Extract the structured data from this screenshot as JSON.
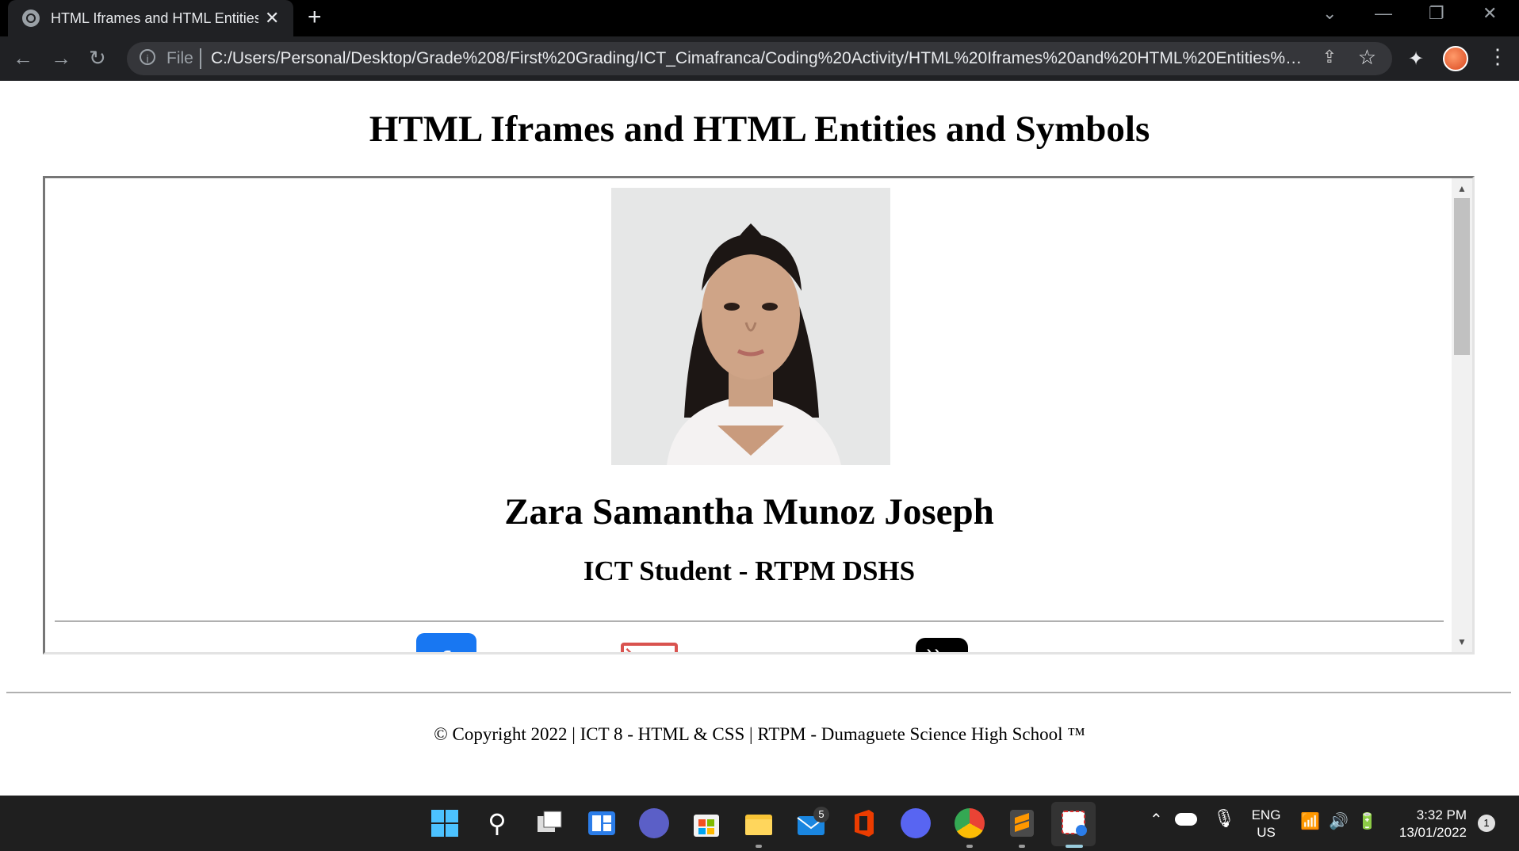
{
  "browser": {
    "tab_title": "HTML Iframes and HTML Entities",
    "tab_close": "✕",
    "new_tab": "+",
    "address_scheme": "File",
    "address_url": "C:/Users/Personal/Desktop/Grade%208/First%20Grading/ICT_Cimafranca/Coding%20Activity/HTML%20Iframes%20and%20HTML%20Entities%20an..."
  },
  "page": {
    "title": "HTML Iframes and HTML Entities and Symbols",
    "iframe": {
      "name": "Zara Samantha Munoz Joseph",
      "role": "ICT Student - RTPM DSHS",
      "facebook_glyph": "f",
      "rss_glyph": "))"
    },
    "footer": "© Copyright 2022 | ICT 8 - HTML & CSS | RTPM - Dumaguete Science High School ™"
  },
  "taskbar": {
    "mail_badge": "5",
    "lang_line1": "ENG",
    "lang_line2": "US",
    "time": "3:32 PM",
    "date": "13/01/2022",
    "notification_count": "1"
  },
  "colors": {
    "facebook": "#1877f2",
    "mail": "#d9534f",
    "chrome_dark": "#202124"
  }
}
